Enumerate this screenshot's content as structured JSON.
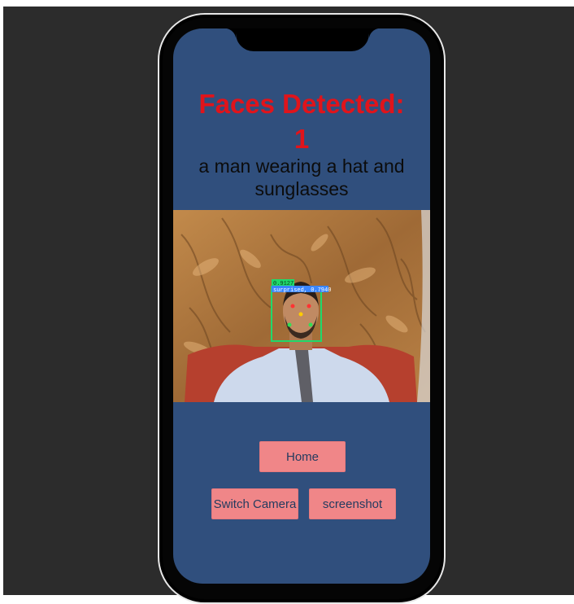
{
  "screen": {
    "title_line1": "Faces Detected:",
    "title_line2": "1",
    "caption": "a man wearing a hat and sunglasses"
  },
  "camera": {
    "detection_score": "0.9127",
    "emotion_label": "surprised, 0.7940"
  },
  "buttons": {
    "home": "Home",
    "switch_camera": "Switch Camera",
    "screenshot": "screenshot"
  },
  "colors": {
    "screen_bg": "#304f7d",
    "title": "#e0141b",
    "button_bg": "#f08688",
    "stage_bg": "#2c2c2c"
  }
}
